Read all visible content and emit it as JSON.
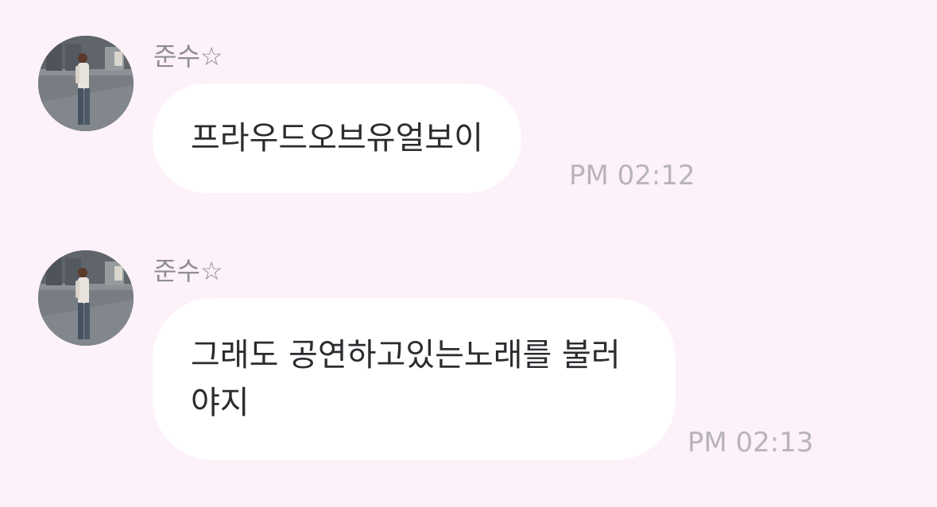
{
  "messages": [
    {
      "sender": "준수☆",
      "text": "프라우드오브유얼보이",
      "time": "PM 02:12"
    },
    {
      "sender": "준수☆",
      "text": "그래도 공연하고있는노래를 불러야지",
      "time": "PM 02:13"
    }
  ],
  "colors": {
    "background": "#fdf1fa",
    "bubble": "#ffffff",
    "message_text": "#2d2b30",
    "sender_name": "#8e8d93",
    "timestamp": "#b8b4bb"
  }
}
